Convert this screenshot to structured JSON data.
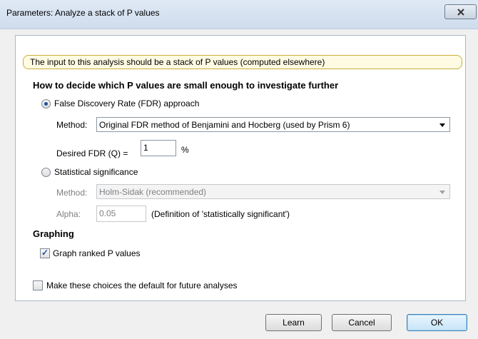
{
  "window": {
    "title": "Parameters: Analyze a stack of P values",
    "close_icon": "close-x-icon"
  },
  "info_banner": "The input to this analysis should be a stack of P values (computed elsewhere)",
  "decide": {
    "heading": "How to decide which P values are small enough to investigate further",
    "fdr": {
      "label": "False Discovery Rate (FDR) approach",
      "selected": true,
      "method_label": "Method:",
      "method_value": "Original FDR method of Benjamini and Hocberg (used by Prism 6)",
      "q_label": "Desired FDR (Q) =",
      "q_value": "1",
      "q_unit": "%"
    },
    "significance": {
      "label": "Statistical significance",
      "selected": false,
      "method_label": "Method:",
      "method_value": "Holm-Sidak (recommended)",
      "alpha_label": "Alpha:",
      "alpha_value": "0.05",
      "alpha_note": "(Definition of 'statistically significant')"
    }
  },
  "graphing": {
    "heading": "Graphing",
    "graph_ranked_label": "Graph ranked P values",
    "graph_ranked_checked": true
  },
  "default_choice": {
    "label": "Make these choices the default for future analyses",
    "checked": false
  },
  "buttons": {
    "learn": "Learn",
    "cancel": "Cancel",
    "ok": "OK"
  }
}
